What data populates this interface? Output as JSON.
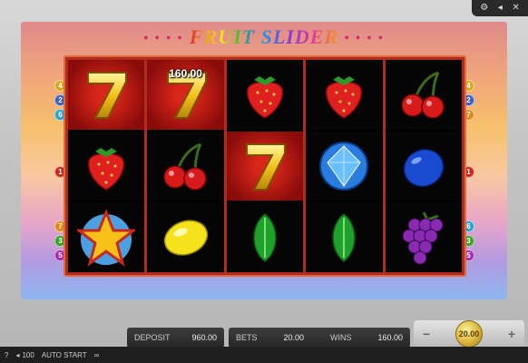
{
  "game": {
    "title_left": "FRUIT",
    "title_right": "SLIDER",
    "title_dots": "• • • •",
    "win_amount": "160.00"
  },
  "top_icons": [
    "gear-icon",
    "volume-icon",
    "close-icon"
  ],
  "top_glyphs": [
    "⚙",
    "◂",
    "✕"
  ],
  "reels": [
    [
      "seven",
      "strawberry",
      "star"
    ],
    [
      "seven",
      "cherries",
      "lemon"
    ],
    [
      "strawberry",
      "seven",
      "melon"
    ],
    [
      "strawberry",
      "diamond",
      "melon"
    ],
    [
      "cherries",
      "plum",
      "grapes"
    ]
  ],
  "winning_cells": [
    [
      0,
      0
    ],
    [
      1,
      0
    ],
    [
      2,
      1
    ]
  ],
  "paylines_left": [
    {
      "n": "4",
      "color": "#d8a81c"
    },
    {
      "n": "2",
      "color": "#3a5ec8"
    },
    {
      "n": "6",
      "color": "#2aa0d0"
    },
    {
      "n": "1",
      "color": "#c8281e"
    },
    {
      "n": "7",
      "color": "#e08a1a"
    },
    {
      "n": "3",
      "color": "#3aa02a"
    },
    {
      "n": "5",
      "color": "#a82ab0"
    }
  ],
  "paylines_right": [
    {
      "n": "4",
      "color": "#d8a81c"
    },
    {
      "n": "2",
      "color": "#3a5ec8"
    },
    {
      "n": "7",
      "color": "#e08a1a"
    },
    {
      "n": "1",
      "color": "#c8281e"
    },
    {
      "n": "6",
      "color": "#2aa0d0"
    },
    {
      "n": "3",
      "color": "#3aa02a"
    },
    {
      "n": "5",
      "color": "#a82ab0"
    }
  ],
  "panel": {
    "deposit_label": "DEPOSIT",
    "deposit_value": "960.00",
    "bets_label": "BETS",
    "bets_value": "20.00",
    "wins_label": "WINS",
    "wins_value": "160.00"
  },
  "bet_control": {
    "minus": "−",
    "plus": "+",
    "coin_value": "20.00"
  },
  "statusbar": {
    "help": "?",
    "autostart_count": "100",
    "autostart_label": "AUTO START",
    "infinity": "∞"
  }
}
